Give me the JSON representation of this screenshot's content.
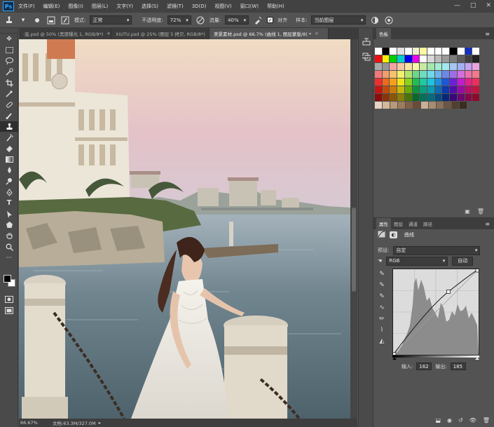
{
  "app": {
    "logo": "Ps"
  },
  "menu": [
    "文件(F)",
    "编辑(E)",
    "图像(I)",
    "图层(L)",
    "文字(Y)",
    "选择(S)",
    "滤镜(T)",
    "3D(D)",
    "视图(V)",
    "窗口(W)",
    "帮助(H)"
  ],
  "window_controls": [
    "—",
    "□",
    "✕"
  ],
  "options": {
    "mode_label": "模式:",
    "mode_value": "正常",
    "opacity_label": "不透明度:",
    "opacity_value": "72%",
    "flow_label": "流量:",
    "flow_value": "40%",
    "aligned_label": "对齐",
    "sample_label": "样本:",
    "sample_value": "当前图层"
  },
  "tabs": [
    {
      "label": "·底.psd @ 50% (黑度曝光 1, RGB/8*)",
      "active": false
    },
    {
      "label": "XIUTU.psd @ 25% (图层 5 拷贝, RGB/8*)",
      "active": false
    },
    {
      "label": "美景素材.psd @ 66.7% (曲线 1, 图层蒙版/8) *",
      "active": true
    }
  ],
  "status": {
    "zoom": "66.67%",
    "doc": "文档:63.3M/327.0M"
  },
  "swatches": {
    "tab": "色板",
    "rows": [
      [
        "#ffffff",
        "#000000",
        "#ffffff",
        "#e0e0e0",
        "#ffffff",
        "#f0f0d0",
        "#fff8a0",
        "#ffffff",
        "#ffffff",
        "#ffffff",
        "#000000",
        "#ffffff",
        "#1030c0",
        "#ffffff"
      ],
      [
        "#ee1111",
        "#ffee00",
        "#00cc00",
        "#00cccc",
        "#0000ee",
        "#ee00ee",
        "#ffffff",
        "#d8d8d8",
        "#bbbbbb",
        "#9a9a9a",
        "#7c7c7c",
        "#5e5e5e",
        "#404040",
        "#222222"
      ],
      [
        "#a8a8a8",
        "#959595",
        "#f2a4a4",
        "#f4c7a4",
        "#f7e3a4",
        "#f6f7a4",
        "#c8eba4",
        "#a4e6b0",
        "#a4ebd4",
        "#a4e8f0",
        "#a4c8f2",
        "#a4b0f0",
        "#c2a4f0",
        "#e8a4e0"
      ],
      [
        "#f07a7a",
        "#f29d6e",
        "#f5c26e",
        "#f2f06e",
        "#b2e46e",
        "#6ed888",
        "#6edcbe",
        "#6ed8ea",
        "#6eb2ec",
        "#6e88e8",
        "#9c6ee8",
        "#d46edc",
        "#ee6eae",
        "#f07a8c"
      ],
      [
        "#ee2e2e",
        "#ee6a1e",
        "#f4a01e",
        "#eee41e",
        "#8ed21e",
        "#1ec050",
        "#1ec8a0",
        "#1ec4dc",
        "#1e8ee0",
        "#1e56d8",
        "#6e1ed8",
        "#be1ecc",
        "#e81e8a",
        "#ee2e5a"
      ],
      [
        "#c41414",
        "#c44a0c",
        "#c87a0c",
        "#c4b80c",
        "#6aa80c",
        "#0c963c",
        "#0c9e7e",
        "#0c9ab0",
        "#0c6cb4",
        "#0c3aac",
        "#500cac",
        "#960ca0",
        "#bc0c6a",
        "#c41440"
      ],
      [
        "#8a0c0c",
        "#8a3408",
        "#8c5608",
        "#8a8008",
        "#4a7608",
        "#086a28",
        "#087058",
        "#086c7c",
        "#084c80",
        "#082878",
        "#380878",
        "#6a0870",
        "#84084a",
        "#8a0c2c"
      ],
      [
        "#e8d4c0",
        "#d2b89c",
        "#b89878",
        "#9c7c5c",
        "#806048",
        "#684c38",
        "#c8b098",
        "#a88c70",
        "#88705a",
        "#6c5644",
        "#50402e",
        "#3a2c20"
      ]
    ]
  },
  "props": {
    "tabs": [
      "属性",
      "图层",
      "通道",
      "路径"
    ],
    "title": "曲线",
    "preset_label": "预设:",
    "preset_value": "自定",
    "channel_value": "RGB",
    "auto_label": "自动",
    "input_label": "输入:",
    "input_value": "162",
    "output_label": "输出:",
    "output_value": "185"
  }
}
